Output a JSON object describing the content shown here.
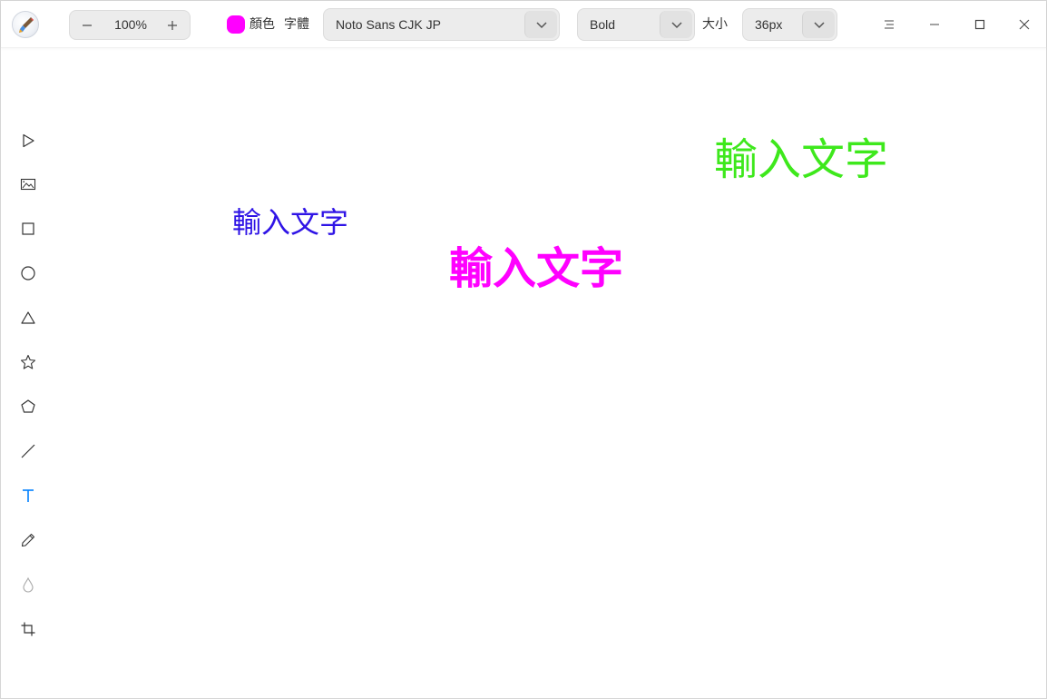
{
  "toolbar": {
    "zoom_value": "100%",
    "color_label": "顏色",
    "color_value": "#ff00ff",
    "font_label": "字體",
    "font_family_value": "Noto Sans CJK JP",
    "font_weight_value": "Bold",
    "size_label": "大小",
    "size_value": "36px"
  },
  "icons": {
    "zoom_minus": "minus-icon",
    "zoom_plus": "plus-icon",
    "dropdown": "chevron-down-icon",
    "menu": "hamburger-menu-icon",
    "minimize": "minimize-icon",
    "maximize": "maximize-icon",
    "close": "close-icon"
  },
  "tools": [
    {
      "name": "select",
      "icon": "cursor-icon"
    },
    {
      "name": "image",
      "icon": "image-icon"
    },
    {
      "name": "rectangle",
      "icon": "rectangle-icon"
    },
    {
      "name": "ellipse",
      "icon": "circle-icon"
    },
    {
      "name": "triangle",
      "icon": "triangle-icon"
    },
    {
      "name": "star",
      "icon": "star-icon"
    },
    {
      "name": "polygon",
      "icon": "pentagon-icon"
    },
    {
      "name": "line",
      "icon": "line-icon"
    },
    {
      "name": "text",
      "icon": "text-icon",
      "active": true
    },
    {
      "name": "pen",
      "icon": "pencil-icon"
    },
    {
      "name": "blur",
      "icon": "drop-icon"
    },
    {
      "name": "crop",
      "icon": "crop-icon"
    }
  ],
  "canvas": {
    "texts": [
      {
        "text": "輸入文字",
        "color": "#2f14e6"
      },
      {
        "text": "輸入文字",
        "color": "#ff00ff"
      },
      {
        "text": "輸入文字",
        "color": "#3ee81c"
      }
    ]
  },
  "colors": {
    "accent": "#0081ff",
    "active_color": "#ff00ff"
  }
}
